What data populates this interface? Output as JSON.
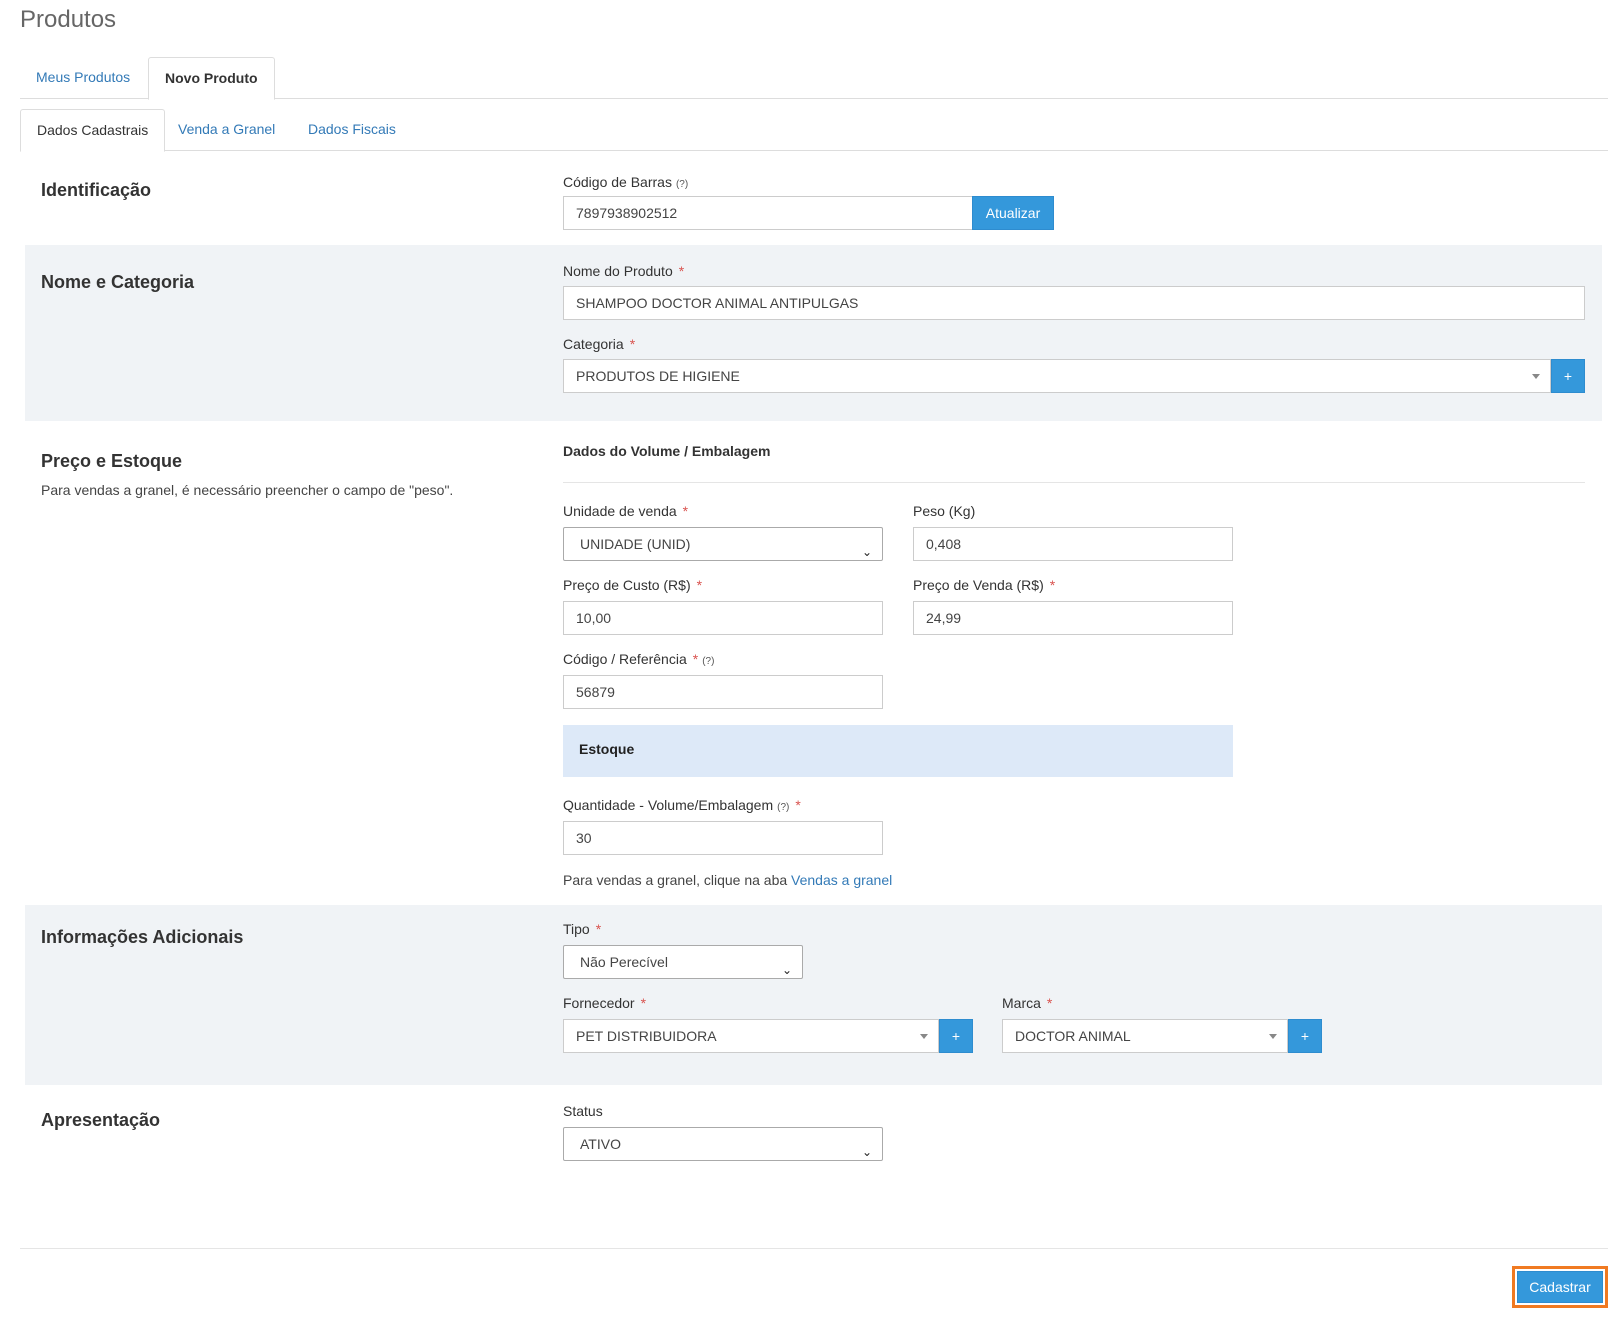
{
  "page": {
    "title": "Produtos"
  },
  "tabs": [
    {
      "label": "Meus Produtos",
      "active": false
    },
    {
      "label": "Novo Produto",
      "active": true
    }
  ],
  "subtabs": [
    {
      "label": "Dados Cadastrais",
      "active": true
    },
    {
      "label": "Venda a Granel",
      "active": false
    },
    {
      "label": "Dados Fiscais",
      "active": false
    }
  ],
  "identificacao": {
    "title": "Identificação",
    "barcode_label": "Código de Barras",
    "barcode_help": "(?)",
    "barcode_value": "7897938902512",
    "update_button": "Atualizar"
  },
  "nome_categoria": {
    "title": "Nome e Categoria",
    "name_label": "Nome do Produto",
    "name_value": "SHAMPOO DOCTOR ANIMAL ANTIPULGAS",
    "category_label": "Categoria",
    "category_value": "PRODUTOS DE HIGIENE",
    "add_button": "+"
  },
  "preco_estoque": {
    "title": "Preço e Estoque",
    "note": "Para vendas a granel, é necessário preencher o campo de \"peso\".",
    "volume_heading": "Dados do Volume / Embalagem",
    "unit_label": "Unidade de venda",
    "unit_value": "UNIDADE (UNID)",
    "weight_label": "Peso (Kg)",
    "weight_value": "0,408",
    "cost_label": "Preço de Custo (R$)",
    "cost_value": "10,00",
    "sale_label": "Preço de Venda (R$)",
    "sale_value": "24,99",
    "code_label": "Código / Referência",
    "code_help": "(?)",
    "code_value": "56879",
    "stock_heading": "Estoque",
    "qty_label": "Quantidade - Volume/Embalagem",
    "qty_help": "(?)",
    "qty_value": "30",
    "hint_text": "Para vendas a granel, clique na aba ",
    "hint_link": "Vendas a granel"
  },
  "info_adicionais": {
    "title": "Informações Adicionais",
    "type_label": "Tipo",
    "type_value": "Não Perecível",
    "supplier_label": "Fornecedor",
    "supplier_value": "PET DISTRIBUIDORA",
    "brand_label": "Marca",
    "brand_value": "DOCTOR ANIMAL",
    "add_button": "+"
  },
  "apresentacao": {
    "title": "Apresentação",
    "status_label": "Status",
    "status_value": "ATIVO"
  },
  "footer": {
    "submit_button": "Cadastrar"
  },
  "icons": {
    "dropdown": "caret-down-icon",
    "select": "chevron-down-icon"
  },
  "colors": {
    "accent": "#3498db",
    "highlight": "#f07a22",
    "required": "#d9534f",
    "shaded": "#f0f3f6",
    "stock_box": "#dde9f8"
  }
}
